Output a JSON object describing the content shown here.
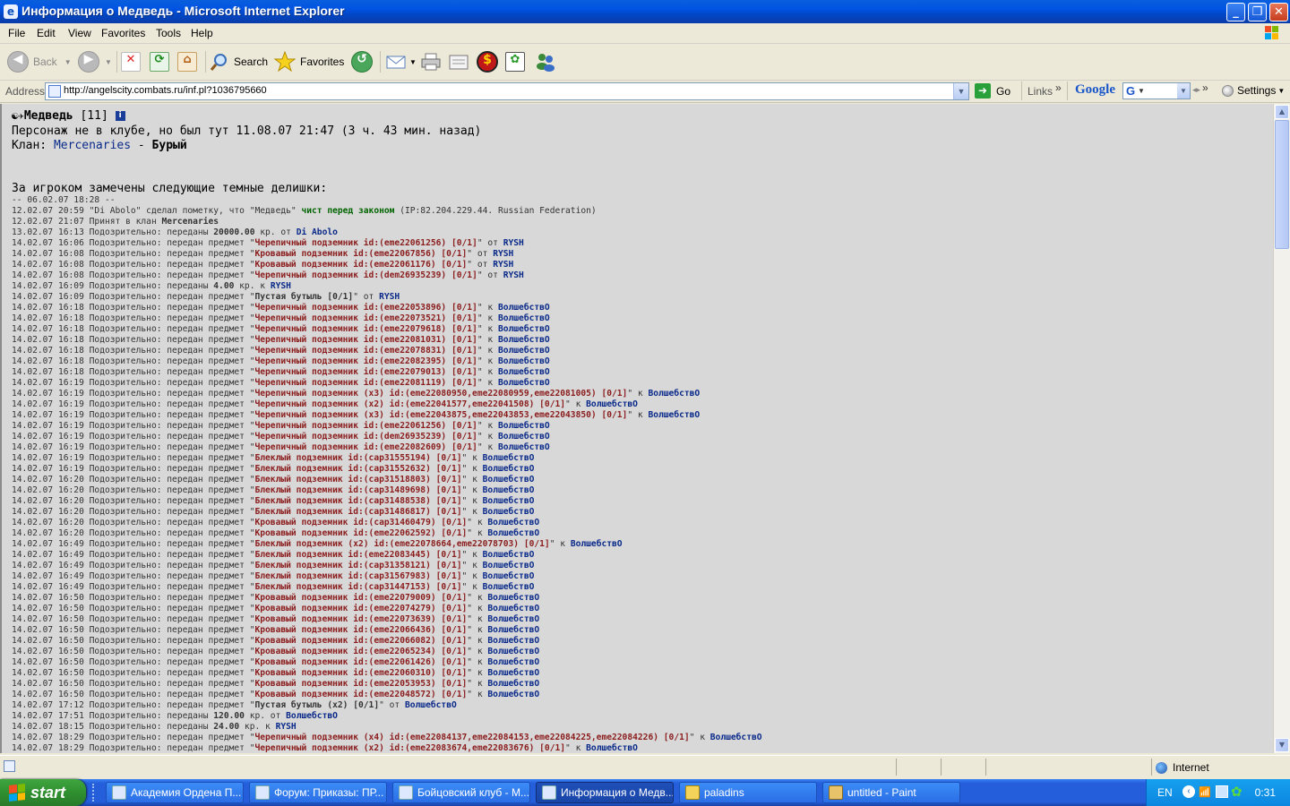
{
  "window": {
    "title": "Информация о Медведь - Microsoft Internet Explorer"
  },
  "menu": [
    "File",
    "Edit",
    "View",
    "Favorites",
    "Tools",
    "Help"
  ],
  "toolbar": {
    "back": "Back",
    "search": "Search",
    "favorites": "Favorites"
  },
  "address": {
    "label": "Address",
    "url": "http://angelscity.combats.ru/inf.pl?1036795660",
    "go": "Go",
    "links": "Links",
    "google": "Google",
    "settings": "Settings"
  },
  "page": {
    "name": "Медведь",
    "level": "[11]",
    "status_line": "Персонаж не в клубе, но был тут 11.08.07 21:47 (3 ч. 43 мин. назад)",
    "clan_label": "Клан:",
    "clan_name": "Mercenaries",
    "clan_rank": "Бурый",
    "dark_deeds": "За игроком замечены следующие темные делишки:",
    "log": [
      [
        {
          "t": "-- 06.02.07 18:28 --",
          "c": ""
        }
      ],
      [
        {
          "t": "12.02.07 20:59 \"Di Abolo\" сделал пометку, что \"Медведь\" ",
          "c": ""
        },
        {
          "t": "чист перед законом",
          "c": "grn"
        },
        {
          "t": " (IP:82.204.229.44. Russian Federation)",
          "c": ""
        }
      ],
      [
        {
          "t": "12.02.07 21:07 Принят в клан ",
          "c": ""
        },
        {
          "t": "Mercenaries",
          "c": "b"
        }
      ],
      [
        {
          "t": "13.02.07 16:13 Подозрительно: переданы ",
          "c": ""
        },
        {
          "t": "20000.00",
          "c": "b"
        },
        {
          "t": " кр. от ",
          "c": ""
        },
        {
          "t": "Di Abolo",
          "c": "usr"
        }
      ],
      [
        {
          "t": "14.02.07 16:06 Подозрительно: передан предмет \"",
          "c": ""
        },
        {
          "t": "Черепичный подземник id:(eme22061256) [0/1]",
          "c": "item"
        },
        {
          "t": "\" от ",
          "c": ""
        },
        {
          "t": "RYSH",
          "c": "usr"
        }
      ],
      [
        {
          "t": "14.02.07 16:08 Подозрительно: передан предмет \"",
          "c": ""
        },
        {
          "t": "Кровавый подземник id:(eme22067856) [0/1]",
          "c": "item"
        },
        {
          "t": "\" от ",
          "c": ""
        },
        {
          "t": "RYSH",
          "c": "usr"
        }
      ],
      [
        {
          "t": "14.02.07 16:08 Подозрительно: передан предмет \"",
          "c": ""
        },
        {
          "t": "Кровавый подземник id:(eme22061176) [0/1]",
          "c": "item"
        },
        {
          "t": "\" от ",
          "c": ""
        },
        {
          "t": "RYSH",
          "c": "usr"
        }
      ],
      [
        {
          "t": "14.02.07 16:08 Подозрительно: передан предмет \"",
          "c": ""
        },
        {
          "t": "Черепичный подземник id:(dem26935239) [0/1]",
          "c": "item"
        },
        {
          "t": "\" от ",
          "c": ""
        },
        {
          "t": "RYSH",
          "c": "usr"
        }
      ],
      [
        {
          "t": "14.02.07 16:09 Подозрительно: переданы ",
          "c": ""
        },
        {
          "t": "4.00",
          "c": "b"
        },
        {
          "t": " кр. к ",
          "c": ""
        },
        {
          "t": "RYSH",
          "c": "usr"
        }
      ],
      [
        {
          "t": "14.02.07 16:09 Подозрительно: передан предмет \"",
          "c": ""
        },
        {
          "t": "Пустая бутыль [0/1]",
          "c": "b"
        },
        {
          "t": "\" от ",
          "c": ""
        },
        {
          "t": "RYSH",
          "c": "usr"
        }
      ],
      [
        {
          "t": "14.02.07 16:18 Подозрительно: передан предмет \"",
          "c": ""
        },
        {
          "t": "Черепичный подземник id:(eme22053896) [0/1]",
          "c": "item"
        },
        {
          "t": "\" к ",
          "c": ""
        },
        {
          "t": "ВолшебствО",
          "c": "usr"
        }
      ],
      [
        {
          "t": "14.02.07 16:18 Подозрительно: передан предмет \"",
          "c": ""
        },
        {
          "t": "Черепичный подземник id:(eme22073521) [0/1]",
          "c": "item"
        },
        {
          "t": "\" к ",
          "c": ""
        },
        {
          "t": "ВолшебствО",
          "c": "usr"
        }
      ],
      [
        {
          "t": "14.02.07 16:18 Подозрительно: передан предмет \"",
          "c": ""
        },
        {
          "t": "Черепичный подземник id:(eme22079618) [0/1]",
          "c": "item"
        },
        {
          "t": "\" к ",
          "c": ""
        },
        {
          "t": "ВолшебствО",
          "c": "usr"
        }
      ],
      [
        {
          "t": "14.02.07 16:18 Подозрительно: передан предмет \"",
          "c": ""
        },
        {
          "t": "Черепичный подземник id:(eme22081031) [0/1]",
          "c": "item"
        },
        {
          "t": "\" к ",
          "c": ""
        },
        {
          "t": "ВолшебствО",
          "c": "usr"
        }
      ],
      [
        {
          "t": "14.02.07 16:18 Подозрительно: передан предмет \"",
          "c": ""
        },
        {
          "t": "Черепичный подземник id:(eme22078831) [0/1]",
          "c": "item"
        },
        {
          "t": "\" к ",
          "c": ""
        },
        {
          "t": "ВолшебствО",
          "c": "usr"
        }
      ],
      [
        {
          "t": "14.02.07 16:18 Подозрительно: передан предмет \"",
          "c": ""
        },
        {
          "t": "Черепичный подземник id:(eme22082395) [0/1]",
          "c": "item"
        },
        {
          "t": "\" к ",
          "c": ""
        },
        {
          "t": "ВолшебствО",
          "c": "usr"
        }
      ],
      [
        {
          "t": "14.02.07 16:18 Подозрительно: передан предмет \"",
          "c": ""
        },
        {
          "t": "Черепичный подземник id:(eme22079013) [0/1]",
          "c": "item"
        },
        {
          "t": "\" к ",
          "c": ""
        },
        {
          "t": "ВолшебствО",
          "c": "usr"
        }
      ],
      [
        {
          "t": "14.02.07 16:19 Подозрительно: передан предмет \"",
          "c": ""
        },
        {
          "t": "Черепичный подземник id:(eme22081119) [0/1]",
          "c": "item"
        },
        {
          "t": "\" к ",
          "c": ""
        },
        {
          "t": "ВолшебствО",
          "c": "usr"
        }
      ],
      [
        {
          "t": "14.02.07 16:19 Подозрительно: передан предмет \"",
          "c": ""
        },
        {
          "t": "Черепичный подземник (x3) id:(eme22080950,eme22080959,eme22081005) [0/1]",
          "c": "item"
        },
        {
          "t": "\" к ",
          "c": ""
        },
        {
          "t": "ВолшебствО",
          "c": "usr"
        }
      ],
      [
        {
          "t": "14.02.07 16:19 Подозрительно: передан предмет \"",
          "c": ""
        },
        {
          "t": "Черепичный подземник (x2) id:(eme22041577,eme22041508) [0/1]",
          "c": "item"
        },
        {
          "t": "\" к ",
          "c": ""
        },
        {
          "t": "ВолшебствО",
          "c": "usr"
        }
      ],
      [
        {
          "t": "14.02.07 16:19 Подозрительно: передан предмет \"",
          "c": ""
        },
        {
          "t": "Черепичный подземник (x3) id:(eme22043875,eme22043853,eme22043850) [0/1]",
          "c": "item"
        },
        {
          "t": "\" к ",
          "c": ""
        },
        {
          "t": "ВолшебствО",
          "c": "usr"
        }
      ],
      [
        {
          "t": "14.02.07 16:19 Подозрительно: передан предмет \"",
          "c": ""
        },
        {
          "t": "Черепичный подземник id:(eme22061256) [0/1]",
          "c": "item"
        },
        {
          "t": "\" к ",
          "c": ""
        },
        {
          "t": "ВолшебствО",
          "c": "usr"
        }
      ],
      [
        {
          "t": "14.02.07 16:19 Подозрительно: передан предмет \"",
          "c": ""
        },
        {
          "t": "Черепичный подземник id:(dem26935239) [0/1]",
          "c": "item"
        },
        {
          "t": "\" к ",
          "c": ""
        },
        {
          "t": "ВолшебствО",
          "c": "usr"
        }
      ],
      [
        {
          "t": "14.02.07 16:19 Подозрительно: передан предмет \"",
          "c": ""
        },
        {
          "t": "Черепичный подземник id:(eme22082609) [0/1]",
          "c": "item"
        },
        {
          "t": "\" к ",
          "c": ""
        },
        {
          "t": "ВолшебствО",
          "c": "usr"
        }
      ],
      [
        {
          "t": "14.02.07 16:19 Подозрительно: передан предмет \"",
          "c": ""
        },
        {
          "t": "Блеклый подземник id:(cap31555194) [0/1]",
          "c": "item"
        },
        {
          "t": "\" к ",
          "c": ""
        },
        {
          "t": "ВолшебствО",
          "c": "usr"
        }
      ],
      [
        {
          "t": "14.02.07 16:19 Подозрительно: передан предмет \"",
          "c": ""
        },
        {
          "t": "Блеклый подземник id:(cap31552632) [0/1]",
          "c": "item"
        },
        {
          "t": "\" к ",
          "c": ""
        },
        {
          "t": "ВолшебствО",
          "c": "usr"
        }
      ],
      [
        {
          "t": "14.02.07 16:20 Подозрительно: передан предмет \"",
          "c": ""
        },
        {
          "t": "Блеклый подземник id:(cap31518803) [0/1]",
          "c": "item"
        },
        {
          "t": "\" к ",
          "c": ""
        },
        {
          "t": "ВолшебствО",
          "c": "usr"
        }
      ],
      [
        {
          "t": "14.02.07 16:20 Подозрительно: передан предмет \"",
          "c": ""
        },
        {
          "t": "Блеклый подземник id:(cap31489698) [0/1]",
          "c": "item"
        },
        {
          "t": "\" к ",
          "c": ""
        },
        {
          "t": "ВолшебствО",
          "c": "usr"
        }
      ],
      [
        {
          "t": "14.02.07 16:20 Подозрительно: передан предмет \"",
          "c": ""
        },
        {
          "t": "Блеклый подземник id:(cap31488538) [0/1]",
          "c": "item"
        },
        {
          "t": "\" к ",
          "c": ""
        },
        {
          "t": "ВолшебствО",
          "c": "usr"
        }
      ],
      [
        {
          "t": "14.02.07 16:20 Подозрительно: передан предмет \"",
          "c": ""
        },
        {
          "t": "Блеклый подземник id:(cap31486817) [0/1]",
          "c": "item"
        },
        {
          "t": "\" к ",
          "c": ""
        },
        {
          "t": "ВолшебствО",
          "c": "usr"
        }
      ],
      [
        {
          "t": "14.02.07 16:20 Подозрительно: передан предмет \"",
          "c": ""
        },
        {
          "t": "Кровавый подземник id:(cap31460479) [0/1]",
          "c": "item"
        },
        {
          "t": "\" к ",
          "c": ""
        },
        {
          "t": "ВолшебствО",
          "c": "usr"
        }
      ],
      [
        {
          "t": "14.02.07 16:20 Подозрительно: передан предмет \"",
          "c": ""
        },
        {
          "t": "Кровавый подземник id:(eme22062592) [0/1]",
          "c": "item"
        },
        {
          "t": "\" к ",
          "c": ""
        },
        {
          "t": "ВолшебствО",
          "c": "usr"
        }
      ],
      [
        {
          "t": "14.02.07 16:49 Подозрительно: передан предмет \"",
          "c": ""
        },
        {
          "t": "Блеклый подземник (x2) id:(eme22078664,eme22078703) [0/1]",
          "c": "item"
        },
        {
          "t": "\" к ",
          "c": ""
        },
        {
          "t": "ВолшебствО",
          "c": "usr"
        }
      ],
      [
        {
          "t": "14.02.07 16:49 Подозрительно: передан предмет \"",
          "c": ""
        },
        {
          "t": "Блеклый подземник id:(eme22083445) [0/1]",
          "c": "item"
        },
        {
          "t": "\" к ",
          "c": ""
        },
        {
          "t": "ВолшебствО",
          "c": "usr"
        }
      ],
      [
        {
          "t": "14.02.07 16:49 Подозрительно: передан предмет \"",
          "c": ""
        },
        {
          "t": "Блеклый подземник id:(cap31358121) [0/1]",
          "c": "item"
        },
        {
          "t": "\" к ",
          "c": ""
        },
        {
          "t": "ВолшебствО",
          "c": "usr"
        }
      ],
      [
        {
          "t": "14.02.07 16:49 Подозрительно: передан предмет \"",
          "c": ""
        },
        {
          "t": "Блеклый подземник id:(cap31567983) [0/1]",
          "c": "item"
        },
        {
          "t": "\" к ",
          "c": ""
        },
        {
          "t": "ВолшебствО",
          "c": "usr"
        }
      ],
      [
        {
          "t": "14.02.07 16:49 Подозрительно: передан предмет \"",
          "c": ""
        },
        {
          "t": "Блеклый подземник id:(cap31447153) [0/1]",
          "c": "item"
        },
        {
          "t": "\" к ",
          "c": ""
        },
        {
          "t": "ВолшебствО",
          "c": "usr"
        }
      ],
      [
        {
          "t": "14.02.07 16:50 Подозрительно: передан предмет \"",
          "c": ""
        },
        {
          "t": "Кровавый подземник id:(eme22079009) [0/1]",
          "c": "item"
        },
        {
          "t": "\" к ",
          "c": ""
        },
        {
          "t": "ВолшебствО",
          "c": "usr"
        }
      ],
      [
        {
          "t": "14.02.07 16:50 Подозрительно: передан предмет \"",
          "c": ""
        },
        {
          "t": "Кровавый подземник id:(eme22074279) [0/1]",
          "c": "item"
        },
        {
          "t": "\" к ",
          "c": ""
        },
        {
          "t": "ВолшебствО",
          "c": "usr"
        }
      ],
      [
        {
          "t": "14.02.07 16:50 Подозрительно: передан предмет \"",
          "c": ""
        },
        {
          "t": "Кровавый подземник id:(eme22073639) [0/1]",
          "c": "item"
        },
        {
          "t": "\" к ",
          "c": ""
        },
        {
          "t": "ВолшебствО",
          "c": "usr"
        }
      ],
      [
        {
          "t": "14.02.07 16:50 Подозрительно: передан предмет \"",
          "c": ""
        },
        {
          "t": "Кровавый подземник id:(eme22066436) [0/1]",
          "c": "item"
        },
        {
          "t": "\" к ",
          "c": ""
        },
        {
          "t": "ВолшебствО",
          "c": "usr"
        }
      ],
      [
        {
          "t": "14.02.07 16:50 Подозрительно: передан предмет \"",
          "c": ""
        },
        {
          "t": "Кровавый подземник id:(eme22066082) [0/1]",
          "c": "item"
        },
        {
          "t": "\" к ",
          "c": ""
        },
        {
          "t": "ВолшебствО",
          "c": "usr"
        }
      ],
      [
        {
          "t": "14.02.07 16:50 Подозрительно: передан предмет \"",
          "c": ""
        },
        {
          "t": "Кровавый подземник id:(eme22065234) [0/1]",
          "c": "item"
        },
        {
          "t": "\" к ",
          "c": ""
        },
        {
          "t": "ВолшебствО",
          "c": "usr"
        }
      ],
      [
        {
          "t": "14.02.07 16:50 Подозрительно: передан предмет \"",
          "c": ""
        },
        {
          "t": "Кровавый подземник id:(eme22061426) [0/1]",
          "c": "item"
        },
        {
          "t": "\" к ",
          "c": ""
        },
        {
          "t": "ВолшебствО",
          "c": "usr"
        }
      ],
      [
        {
          "t": "14.02.07 16:50 Подозрительно: передан предмет \"",
          "c": ""
        },
        {
          "t": "Кровавый подземник id:(eme22060310) [0/1]",
          "c": "item"
        },
        {
          "t": "\" к ",
          "c": ""
        },
        {
          "t": "ВолшебствО",
          "c": "usr"
        }
      ],
      [
        {
          "t": "14.02.07 16:50 Подозрительно: передан предмет \"",
          "c": ""
        },
        {
          "t": "Кровавый подземник id:(eme22053953) [0/1]",
          "c": "item"
        },
        {
          "t": "\" к ",
          "c": ""
        },
        {
          "t": "ВолшебствО",
          "c": "usr"
        }
      ],
      [
        {
          "t": "14.02.07 16:50 Подозрительно: передан предмет \"",
          "c": ""
        },
        {
          "t": "Кровавый подземник id:(eme22048572) [0/1]",
          "c": "item"
        },
        {
          "t": "\" к ",
          "c": ""
        },
        {
          "t": "ВолшебствО",
          "c": "usr"
        }
      ],
      [
        {
          "t": "14.02.07 17:12 Подозрительно: передан предмет \"",
          "c": ""
        },
        {
          "t": "Пустая бутыль (x2) [0/1]",
          "c": "b"
        },
        {
          "t": "\" от ",
          "c": ""
        },
        {
          "t": "ВолшебствО",
          "c": "usr"
        }
      ],
      [
        {
          "t": "14.02.07 17:51 Подозрительно: переданы ",
          "c": ""
        },
        {
          "t": "120.00",
          "c": "b"
        },
        {
          "t": " кр. от ",
          "c": ""
        },
        {
          "t": "ВолшебствО",
          "c": "usr"
        }
      ],
      [
        {
          "t": "14.02.07 18:15 Подозрительно: переданы ",
          "c": ""
        },
        {
          "t": "24.00",
          "c": "b"
        },
        {
          "t": " кр. к ",
          "c": ""
        },
        {
          "t": "RYSH",
          "c": "usr"
        }
      ],
      [
        {
          "t": "14.02.07 18:29 Подозрительно: передан предмет \"",
          "c": ""
        },
        {
          "t": "Черепичный подземник (x4) id:(eme22084137,eme22084153,eme22084225,eme22084226) [0/1]",
          "c": "item"
        },
        {
          "t": "\" к ",
          "c": ""
        },
        {
          "t": "ВолшебствО",
          "c": "usr"
        }
      ],
      [
        {
          "t": "14.02.07 18:29 Подозрительно: передан предмет \"",
          "c": ""
        },
        {
          "t": "Черепичный подземник (x2) id:(eme22083674,eme22083676) [0/1]",
          "c": "item"
        },
        {
          "t": "\" к ",
          "c": ""
        },
        {
          "t": "ВолшебствО",
          "c": "usr"
        }
      ]
    ]
  },
  "status": {
    "zone": "Internet"
  },
  "taskbar": {
    "start": "start",
    "tasks": [
      {
        "label": "Академия Ордена П...",
        "active": false
      },
      {
        "label": "Форум: Приказы: ПР...",
        "active": false
      },
      {
        "label": "Бойцовский клуб - М...",
        "active": false
      },
      {
        "label": "Информация о Медв...",
        "active": true
      },
      {
        "label": "paladins",
        "active": false
      },
      {
        "label": "untitled - Paint",
        "active": false
      }
    ],
    "lang": "EN",
    "clock": "0:31"
  }
}
